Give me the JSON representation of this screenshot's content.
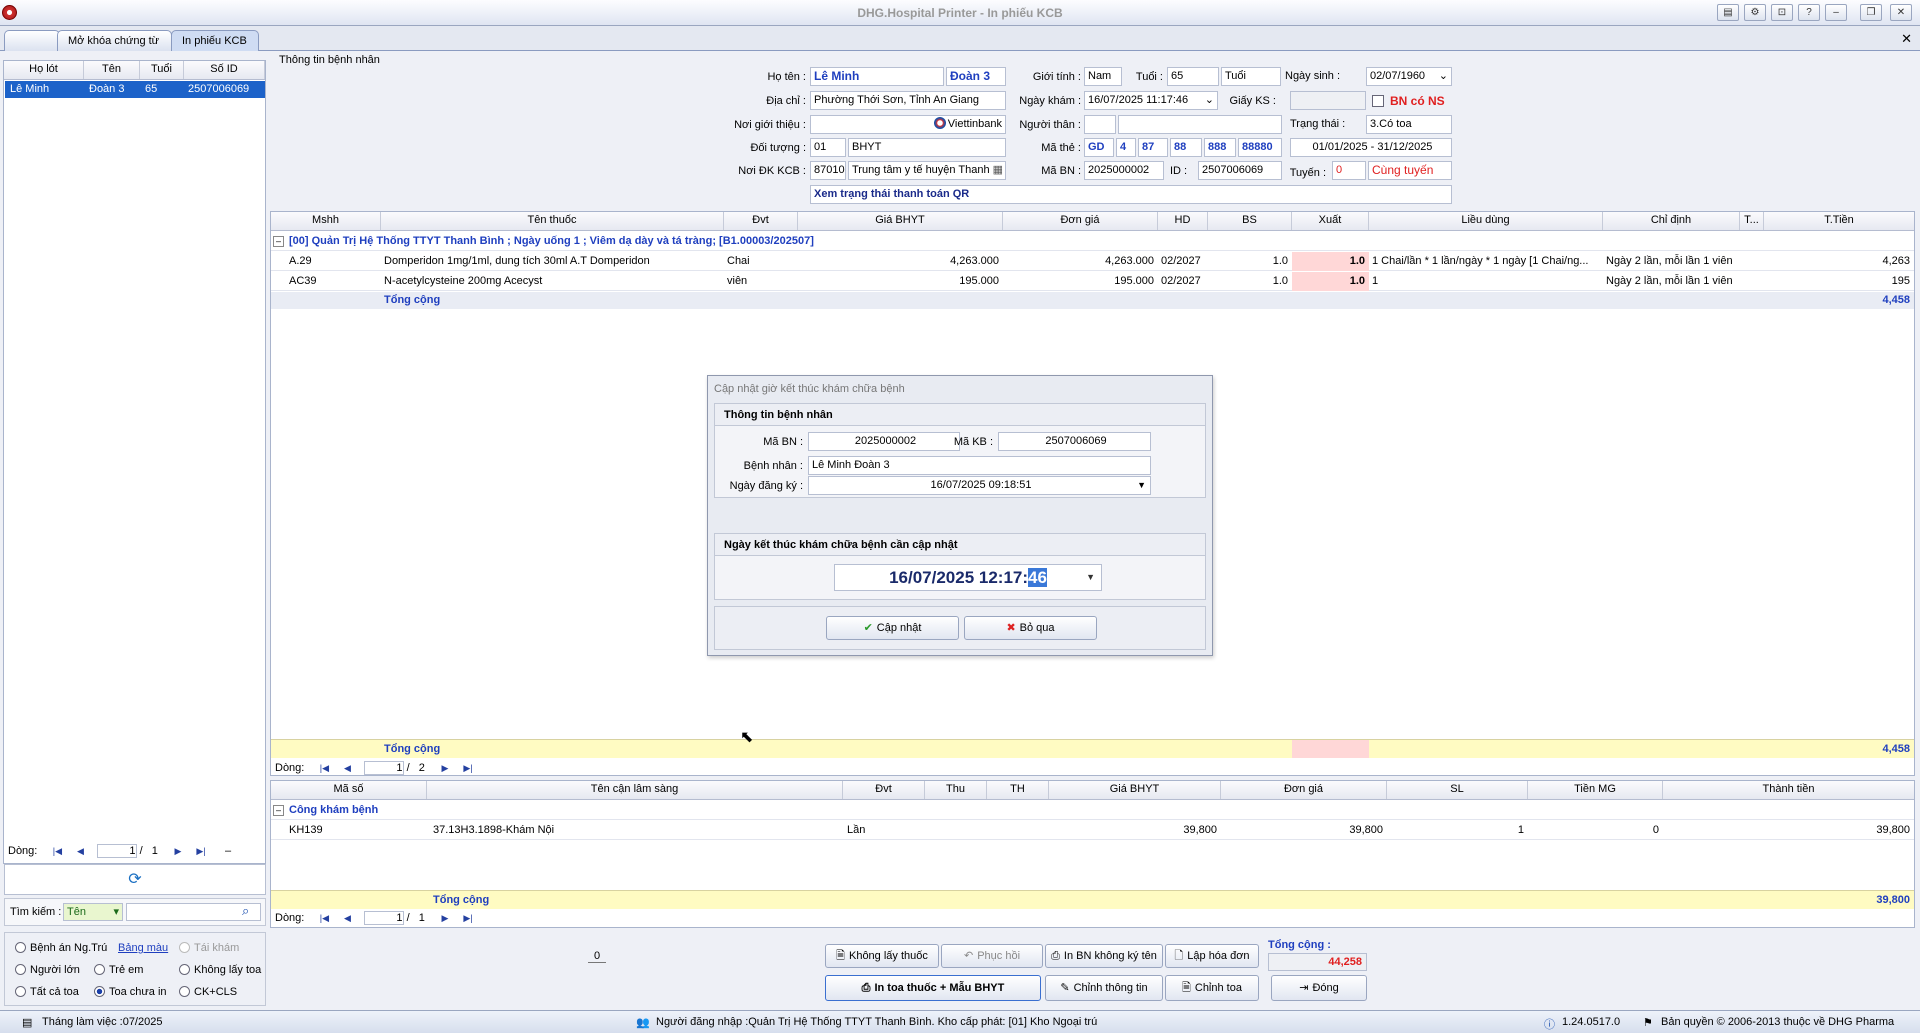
{
  "window": {
    "title": "DHG.Hospital Printer - In phiếu KCB"
  },
  "tabs": [
    {
      "label": ""
    },
    {
      "label": "Mở khóa chứng từ"
    },
    {
      "label": "In phiếu KCB"
    }
  ],
  "patient_list": {
    "headers": [
      "Họ lót",
      "Tên",
      "Tuổi",
      "Số ID"
    ],
    "rows": [
      {
        "ho_lot": "Lê Minh",
        "ten": "Đoàn 3",
        "tuoi": "65",
        "so_id": "2507006069"
      }
    ],
    "pager": {
      "label": "Dòng:",
      "page": "1",
      "sep": "/",
      "total": "1",
      "dash": "–"
    },
    "search": {
      "label": "Tìm kiếm :",
      "field": "Tên",
      "value": ""
    }
  },
  "filters": [
    {
      "label": "Bệnh án Ng.Trú",
      "checked": false
    },
    {
      "label": "Bảng màu",
      "link": true
    },
    {
      "label": "Tái khám",
      "checked": false,
      "disabled": true
    },
    {
      "label": "Người lớn",
      "checked": false
    },
    {
      "label": "Trẻ em",
      "checked": false
    },
    {
      "label": "Không lấy toa",
      "checked": false
    },
    {
      "label": "Tất cả toa",
      "checked": false
    },
    {
      "label": "Toa chưa in",
      "checked": true
    },
    {
      "label": "CK+CLS",
      "checked": false
    }
  ],
  "info": {
    "section_title": "Thông tin bệnh nhân",
    "ho_ten_label": "Họ tên :",
    "ho": "Lê Minh",
    "ten": "Đoàn 3",
    "gioi_tinh_label": "Giới tính :",
    "gioi_tinh": "Nam",
    "tuoi_label": "Tuổi :",
    "tuoi": "65",
    "tuoi_unit": "Tuổi",
    "ngay_sinh_label": "Ngày sinh :",
    "ngay_sinh": "02/07/1960",
    "dia_chi_label": "Địa chỉ :",
    "dia_chi": "Phường Thới Sơn, Tỉnh An Giang",
    "ngay_kham_label": "Ngày khám :",
    "ngay_kham": "16/07/2025 11:17:46",
    "giay_ks_label": "Giấy KS :",
    "giay_ks": "",
    "bn_co_ns": "BN có NS",
    "noi_gioi_thieu_label": "Nơi giới thiệu :",
    "noi_gioi_thieu": "",
    "bank": "Viettinbank",
    "nguoi_than_label": "Người thân :",
    "nguoi_than": "",
    "trang_thai_label": "Trạng thái :",
    "trang_thai": "3.Có toa",
    "doi_tuong_label": "Đối tượng :",
    "doi_tuong_code": "01",
    "doi_tuong": "BHYT",
    "ma_the_label": "Mã thẻ :",
    "ma_the": [
      "GD",
      "4",
      "87",
      "88",
      "888",
      "88880"
    ],
    "han_the": "01/01/2025 - 31/12/2025",
    "noi_dk_label": "Nơi ĐK KCB :",
    "noi_dk_code": "87010",
    "noi_dk": "Trung tâm y tế huyện Thanh",
    "ma_bn_label": "Mã BN :",
    "ma_bn": "2025000002",
    "id_label": "ID :",
    "id": "2507006069",
    "tuyen_label": "Tuyến :",
    "tuyen_code": "0",
    "tuyen": "Cùng tuyến",
    "qr": "Xem trạng thái thanh toán QR"
  },
  "drugs": {
    "headers": [
      "Mshh",
      "Tên thuốc",
      "Đvt",
      "Giá BHYT",
      "Đơn giá",
      "HD",
      "BS",
      "Xuất",
      "Liều dùng",
      "Chỉ định",
      "T...",
      "T.Tiền"
    ],
    "group": "[00] Quản Trị Hệ Thống TTYT Thanh Bình ; Ngày uống 1 ; Viêm dạ dày và tá tràng; [B1.00003/202507]",
    "rows": [
      {
        "mshh": "A.29",
        "ten": "Domperidon 1mg/1ml, dung tích 30ml A.T Domperidon",
        "dvt": "Chai",
        "gia_bhyt": "4,263.000",
        "don_gia": "4,263.000",
        "hd": "02/2027",
        "bs": "1.0",
        "xuat": "1.0",
        "lieu": "1 Chai/lần * 1 lần/ngày * 1 ngày [1 Chai/ng...",
        "chi_dinh": "Ngày 2 lần, mỗi lần 1 viên",
        "t": "",
        "tien": "4,263"
      },
      {
        "mshh": "AC39",
        "ten": "N-acetylcysteine 200mg Acecyst",
        "dvt": "viên",
        "gia_bhyt": "195.000",
        "don_gia": "195.000",
        "hd": "02/2027",
        "bs": "1.0",
        "xuat": "1.0",
        "lieu": "1",
        "chi_dinh": "Ngày 2 lần, mỗi lần 1 viên",
        "t": "",
        "tien": "195"
      }
    ],
    "total_label": "Tổng cộng",
    "total": "4,458",
    "pager": {
      "label": "Dòng:",
      "page": "1",
      "sep": "/",
      "total": "2"
    }
  },
  "cls": {
    "headers": [
      "Mã số",
      "Tên cận lâm sàng",
      "Đvt",
      "Thu",
      "TH",
      "Giá BHYT",
      "Đơn giá",
      "SL",
      "Tiền MG",
      "Thành tiền"
    ],
    "group": "Công khám bệnh",
    "rows": [
      {
        "ma": "KH139",
        "ten": "37.13H3.1898-Khám Nội",
        "dvt": "Lần",
        "thu": "",
        "th": "",
        "gia_bhyt": "39,800",
        "don_gia": "39,800",
        "sl": "1",
        "tien_mg": "0",
        "thanh_tien": "39,800"
      }
    ],
    "total_label": "Tổng cộng",
    "total": "39,800",
    "pager": {
      "label": "Dòng:",
      "page": "1",
      "sep": "/",
      "total": "1"
    }
  },
  "bottom": {
    "count": "0",
    "buttons": {
      "khong_lay": "Không lấy thuốc",
      "phuc_hoi": "Phục hồi",
      "in_khong_ky": "In BN không ký tên",
      "lap_hoa_don": "Lập hóa đơn",
      "in_toa": "In toa thuốc + Mẫu BHYT",
      "chinh_thong_tin": "Chỉnh thông tin",
      "chinh_toa": "Chỉnh toa",
      "dong": "Đóng"
    },
    "tong_label": "Tổng cộng :",
    "tong": "44,258"
  },
  "dialog": {
    "title": "Cập nhật giờ kết thúc khám chữa bệnh",
    "section1": "Thông tin bệnh nhân",
    "ma_bn_label": "Mã BN :",
    "ma_bn": "2025000002",
    "ma_kb_label": "Mã KB :",
    "ma_kb": "2507006069",
    "benh_nhan_label": "Bệnh nhân :",
    "benh_nhan": "Lê Minh Đoàn 3",
    "ngay_dk_label": "Ngày đăng ký :",
    "ngay_dk": "16/07/2025 09:18:51",
    "section2": "Ngày kết thúc khám chữa bệnh cần cập nhật",
    "end_time_main": "16/07/2025 12:17:",
    "end_time_sel": "46",
    "btn_update": "Cập nhật",
    "btn_skip": "Bỏ qua"
  },
  "status": {
    "month": "Tháng làm việc :07/2025",
    "user": "Người đăng nhập :Quản Trị Hệ Thống TTYT Thanh Bình. Kho cấp phát: [01] Kho Ngoại trú",
    "version": "1.24.0517.0",
    "copyright": "Bản quyền © 2006-2013 thuộc về DHG Pharma"
  },
  "colors": {
    "accent": "#1f3fbf",
    "total_bg": "#fffbc2",
    "red": "#e02020",
    "selected": "#1c62c9"
  }
}
